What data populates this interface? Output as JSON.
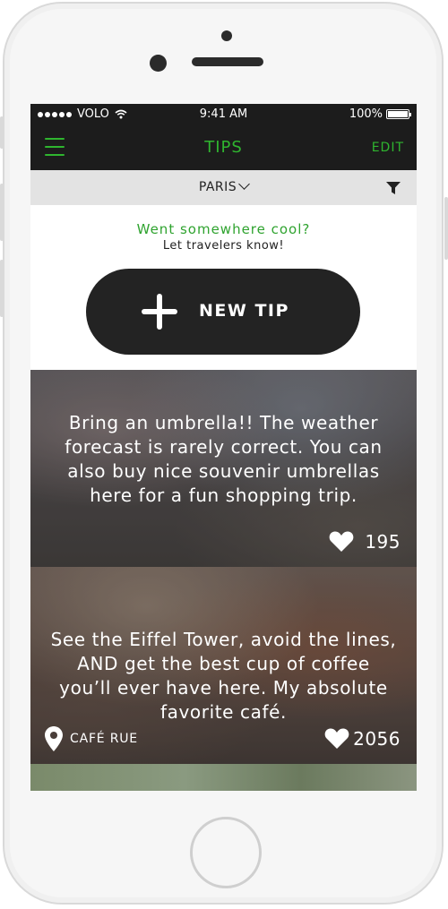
{
  "status_bar": {
    "carrier": "VOLO",
    "time": "9:41 AM",
    "battery": "100%"
  },
  "nav": {
    "title": "TIPS",
    "edit_label": "EDIT"
  },
  "filter": {
    "city": "PARIS"
  },
  "prompt": {
    "headline": "Went somewhere cool?",
    "subline": "Let travelers know!"
  },
  "new_tip": {
    "label": "NEW TIP"
  },
  "tips": [
    {
      "text": "Bring an umbrella!! The weather forecast is rarely correct. You can also buy nice souvenir umbrellas here for a fun shopping trip.",
      "likes": "195"
    },
    {
      "text": "See the Eiffel Tower, avoid the lines, AND get the best cup of coffee you’ll ever have here. My absolute favorite café.",
      "likes": "2056",
      "location": "CAFÉ RUE"
    }
  ],
  "colors": {
    "accent": "#2fb52f",
    "nav_bg": "#1c1c1c",
    "button_bg": "#232323"
  },
  "icons": [
    "hamburger-icon",
    "chevron-down-icon",
    "filter-icon",
    "plus-icon",
    "heart-icon",
    "location-pin-icon",
    "wifi-icon",
    "battery-icon"
  ]
}
